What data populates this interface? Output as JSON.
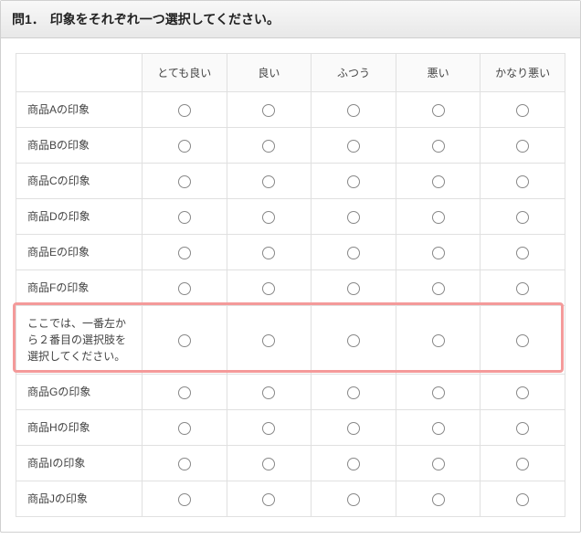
{
  "question": {
    "number": "問1．",
    "text": "印象をそれぞれ一つ選択してください。"
  },
  "columns": [
    "とても良い",
    "良い",
    "ふつう",
    "悪い",
    "かなり悪い"
  ],
  "rows": [
    {
      "label": "商品Aの印象",
      "highlight": false
    },
    {
      "label": "商品Bの印象",
      "highlight": false
    },
    {
      "label": "商品Cの印象",
      "highlight": false
    },
    {
      "label": "商品Dの印象",
      "highlight": false
    },
    {
      "label": "商品Eの印象",
      "highlight": false
    },
    {
      "label": "商品Fの印象",
      "highlight": false
    },
    {
      "label": "ここでは、一番左から２番目の選択肢を選択してください。",
      "highlight": true
    },
    {
      "label": "商品Gの印象",
      "highlight": false
    },
    {
      "label": "商品Hの印象",
      "highlight": false
    },
    {
      "label": "商品Iの印象",
      "highlight": false
    },
    {
      "label": "商品Jの印象",
      "highlight": false
    }
  ]
}
